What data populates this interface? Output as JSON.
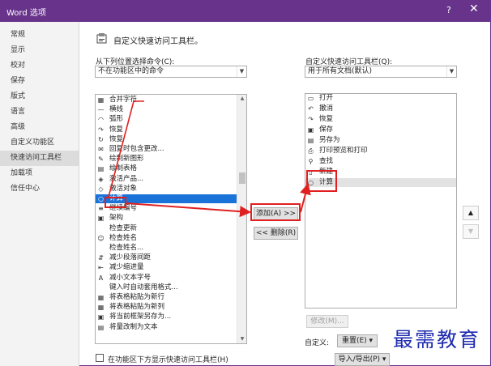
{
  "window": {
    "title": "Word 选项",
    "help": "?",
    "close": "✕"
  },
  "sidebar": {
    "items": [
      {
        "label": "常规"
      },
      {
        "label": "显示"
      },
      {
        "label": "校对"
      },
      {
        "label": "保存"
      },
      {
        "label": "版式"
      },
      {
        "label": "语言"
      },
      {
        "label": "高级"
      },
      {
        "label": "自定义功能区"
      },
      {
        "label": "快速访问工具栏",
        "active": true
      },
      {
        "label": "加载项"
      },
      {
        "label": "信任中心"
      }
    ]
  },
  "header": {
    "title": "自定义快速访问工具栏。"
  },
  "left_panel": {
    "label": "从下列位置选择命令(C):",
    "dropdown_value": "不在功能区中的命令",
    "commands": [
      {
        "label": "合并字符",
        "icon": "merge-chars-icon",
        "glyph": "▦"
      },
      {
        "label": "横线",
        "icon": "horizontal-line-icon",
        "glyph": "—"
      },
      {
        "label": "弧形",
        "icon": "arc-icon",
        "glyph": "◠"
      },
      {
        "label": "恢复",
        "icon": "redo-icon",
        "glyph": "↷"
      },
      {
        "label": "恢复",
        "icon": "restore-icon",
        "glyph": "↻"
      },
      {
        "label": "回复时包含更改...",
        "icon": "reply-icon",
        "glyph": "✉"
      },
      {
        "label": "绘制新图形",
        "icon": "draw-shape-icon",
        "glyph": "✎"
      },
      {
        "label": "绘制表格",
        "icon": "draw-table-icon",
        "glyph": "▤"
      },
      {
        "label": "激活产品...",
        "icon": "activate-icon",
        "glyph": "◈"
      },
      {
        "label": "激活对象",
        "icon": "activate-object-icon",
        "glyph": "◇"
      },
      {
        "label": "计算",
        "icon": "calculate-icon",
        "glyph": "○",
        "selected": true
      },
      {
        "label": "继续编号",
        "icon": "continue-numbering-icon",
        "glyph": "≡"
      },
      {
        "label": "架构",
        "icon": "schema-icon",
        "glyph": "▣"
      },
      {
        "label": "检查更新",
        "icon": "check-update-icon",
        "glyph": ""
      },
      {
        "label": "检查姓名",
        "icon": "check-names-icon",
        "glyph": "☺"
      },
      {
        "label": "检查姓名...",
        "icon": "check-names-dialog-icon",
        "glyph": ""
      },
      {
        "label": "减少段落间距",
        "icon": "decrease-spacing-icon",
        "glyph": "⇵"
      },
      {
        "label": "减少缩进量",
        "icon": "decrease-indent-icon",
        "glyph": "⇤"
      },
      {
        "label": "减小文本字号",
        "icon": "shrink-font-icon",
        "glyph": "A"
      },
      {
        "label": "键入时自动套用格式...",
        "icon": "autoformat-icon",
        "glyph": ""
      },
      {
        "label": "将表格粘贴为新行",
        "icon": "paste-rows-icon",
        "glyph": "▦"
      },
      {
        "label": "将表格粘贴为新列",
        "icon": "paste-cols-icon",
        "glyph": "▦"
      },
      {
        "label": "将当前框架另存为...",
        "icon": "save-frame-icon",
        "glyph": "▣"
      },
      {
        "label": "将量改制为文本",
        "icon": "convert-text-icon",
        "glyph": "▤"
      }
    ]
  },
  "right_panel": {
    "label": "自定义快速访问工具栏(Q):",
    "dropdown_value": "用于所有文档(默认)",
    "commands": [
      {
        "label": "打开",
        "icon": "open-folder-icon",
        "glyph": "▭"
      },
      {
        "label": "撤消",
        "icon": "undo-icon",
        "glyph": "↶"
      },
      {
        "label": "恢复",
        "icon": "redo-icon",
        "glyph": "↷"
      },
      {
        "label": "保存",
        "icon": "save-icon",
        "glyph": "▣"
      },
      {
        "label": "另存为",
        "icon": "save-as-icon",
        "glyph": "▤"
      },
      {
        "label": "打印预览和打印",
        "icon": "print-preview-icon",
        "glyph": "⎙"
      },
      {
        "label": "查找",
        "icon": "find-icon",
        "glyph": "⚲"
      },
      {
        "label": "新建",
        "icon": "new-doc-icon",
        "glyph": "▯"
      },
      {
        "label": "计算",
        "icon": "calculate-icon",
        "glyph": "○",
        "highlighted": true
      }
    ]
  },
  "buttons": {
    "add": "添加(A) >>",
    "remove": "<< 删除(R)",
    "modify": "修改(M)...",
    "move_up": "▲",
    "move_down": "▼"
  },
  "bottom": {
    "customize_label": "自定义:",
    "reset": "重置(E) ▾",
    "import_export": "导入/导出(P) ▾",
    "show_below_ribbon": "在功能区下方显示快速访问工具栏(H)"
  },
  "watermark": "最需教育",
  "colors": {
    "titlebar": "#68338b",
    "selection": "#1a73d9",
    "annotation": "#e02020",
    "watermark": "#1f2bb0"
  }
}
